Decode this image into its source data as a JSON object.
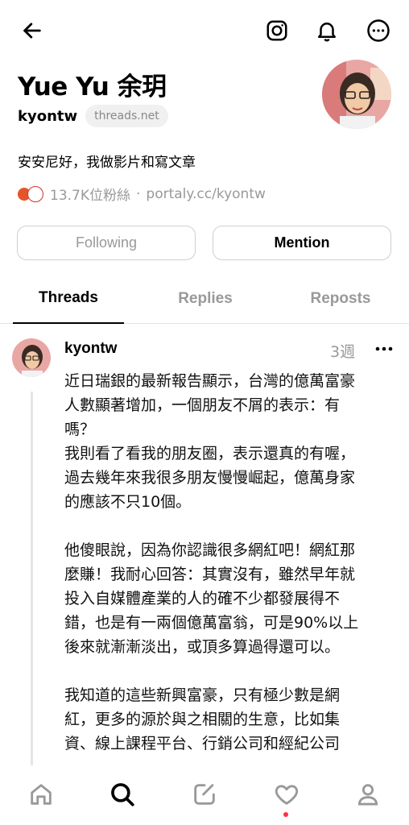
{
  "header": {
    "back_icon": "arrow-left-icon",
    "instagram_icon": "instagram-icon",
    "notifications_icon": "bell-icon",
    "more_icon": "more-circle-icon"
  },
  "profile": {
    "name": "Yue Yu 余玥",
    "username": "kyontw",
    "domain_badge": "threads.net",
    "bio": "安安尼好，我做影片和寫文章",
    "followers": "13.7K位粉絲",
    "separator": "·",
    "link": "portaly.cc/kyontw"
  },
  "actions": {
    "following_label": "Following",
    "mention_label": "Mention"
  },
  "tabs": [
    {
      "label": "Threads",
      "active": true
    },
    {
      "label": "Replies",
      "active": false
    },
    {
      "label": "Reposts",
      "active": false
    }
  ],
  "post": {
    "username": "kyontw",
    "time": "3週",
    "lines": [
      "近日瑞銀的最新報告顯示，台灣的億萬富豪",
      "人數顯著增加，一個朋友不屑的表示：有",
      "嗎？",
      "我則看了看我的朋友圈，表示還真的有喔，",
      "過去幾年來我很多朋友慢慢崛起，億萬身家",
      "的應該不只10個。",
      "",
      "他傻眼說，因為你認識很多網紅吧！網紅那",
      "麼賺！我耐心回答：其實沒有，雖然早年就",
      "投入自媒體產業的人的確不少都發展得不",
      "錯，也是有一兩個億萬富翁，可是90%以上",
      "後來就漸漸淡出，或頂多算過得還可以。",
      "",
      "我知道的這些新興富豪，只有極少數是網",
      "紅，更多的源於與之相關的生意，比如集",
      "資、線上課程平台、行銷公司和經紀公司"
    ]
  },
  "bottom_nav": [
    {
      "icon": "home-icon"
    },
    {
      "icon": "search-icon",
      "active": true
    },
    {
      "icon": "compose-icon"
    },
    {
      "icon": "heart-icon",
      "badge": true
    },
    {
      "icon": "profile-icon"
    }
  ]
}
